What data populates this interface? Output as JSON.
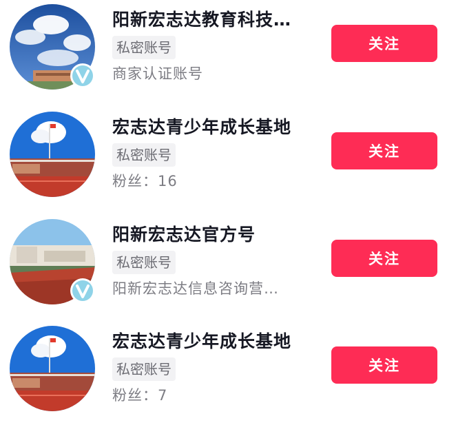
{
  "accounts": [
    {
      "name": "阳新宏志达教育科技…",
      "tag": "私密账号",
      "sub": "商家认证账号",
      "verified": true,
      "avatar": "sky-clouds",
      "follow_label": "关注"
    },
    {
      "name": "宏志达青少年成长基地",
      "tag": "私密账号",
      "sub": "粉丝：16",
      "verified": false,
      "avatar": "school-flag",
      "follow_label": "关注"
    },
    {
      "name": "阳新宏志达官方号",
      "tag": "私密账号",
      "sub": "阳新宏志达信息咨询营…",
      "verified": true,
      "avatar": "school-track",
      "follow_label": "关注"
    },
    {
      "name": "宏志达青少年成长基地",
      "tag": "私密账号",
      "sub": "粉丝：7",
      "verified": false,
      "avatar": "school-flag",
      "follow_label": "关注"
    }
  ],
  "colors": {
    "follow_button": "#fe2c55",
    "name_text": "#161823",
    "secondary_text": "#7c7c83",
    "tag_background": "#f2f2f4",
    "verified_badge": "#8fd3e8"
  }
}
